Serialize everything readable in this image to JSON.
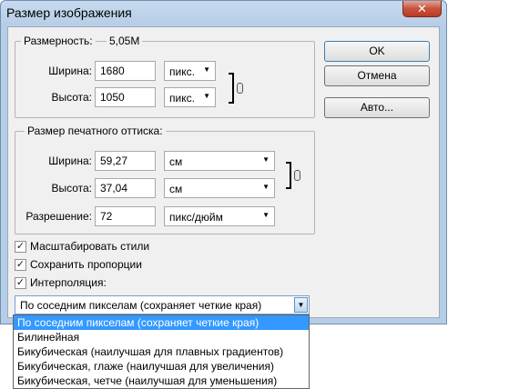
{
  "window": {
    "title": "Размер изображения",
    "close_glyph": "✕"
  },
  "pixel_dims": {
    "legend": "Размерность:",
    "size_value": "5,05M",
    "width_label": "Ширина:",
    "width_value": "1680",
    "width_unit": "пикс.",
    "height_label": "Высота:",
    "height_value": "1050",
    "height_unit": "пикс."
  },
  "print_size": {
    "legend": "Размер печатного оттиска:",
    "width_label": "Ширина:",
    "width_value": "59,27",
    "width_unit": "см",
    "height_label": "Высота:",
    "height_value": "37,04",
    "height_unit": "см",
    "resolution_label": "Разрешение:",
    "resolution_value": "72",
    "resolution_unit": "пикс/дюйм"
  },
  "buttons": {
    "ok": "OK",
    "cancel": "Отмена",
    "auto": "Авто..."
  },
  "options": [
    {
      "label": "Масштабировать стили",
      "checked": true
    },
    {
      "label": "Сохранить пропорции",
      "checked": true
    },
    {
      "label": "Интерполяция:",
      "checked": true
    }
  ],
  "check_glyph": "✓",
  "arrow_glyph": "▼",
  "interpolation": {
    "selected": "По соседним пикселам (сохраняет четкие края)",
    "items": [
      "По соседним пикселам (сохраняет четкие края)",
      "Билинейная",
      "Бикубическая (наилучшая для плавных градиентов)",
      "Бикубическая, глаже (наилучшая для увеличения)",
      "Бикубическая, четче (наилучшая для уменьшения)"
    ]
  },
  "colors": {
    "selection": "#3399ff",
    "title_bar": "#b6cde6",
    "close_button": "#c7523e"
  }
}
